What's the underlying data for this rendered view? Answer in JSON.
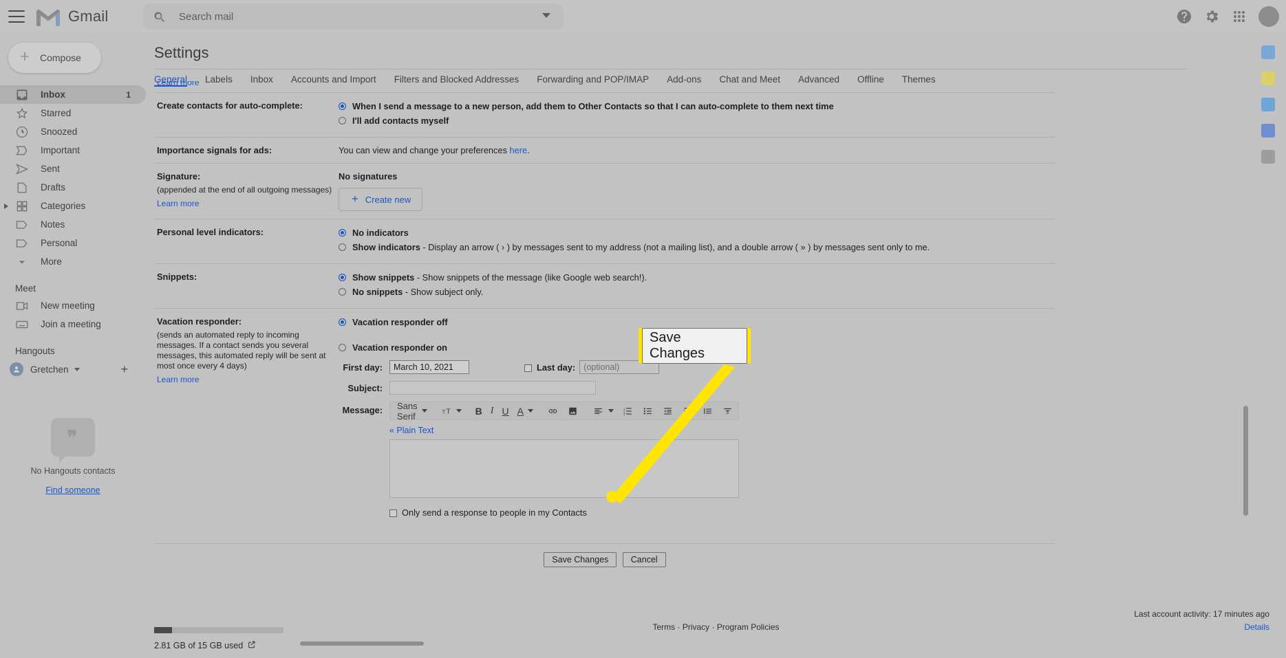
{
  "app": {
    "name": "Gmail",
    "menu_icon": "hamburger-menu-icon",
    "logo_icon": "gmail-m-logo"
  },
  "search": {
    "placeholder": "Search mail",
    "value": "",
    "icon": "search-icon",
    "options_icon": "chevron-down-icon"
  },
  "topbar": {
    "help_icon": "help-circle-icon",
    "settings_icon": "gear-icon",
    "apps_icon": "apps-grid-icon",
    "avatar": "account-avatar"
  },
  "sidebar": {
    "compose": {
      "label": "Compose",
      "icon": "plus-icon"
    },
    "items": [
      {
        "label": "Inbox",
        "icon": "inbox-icon",
        "count": "1",
        "active": true
      },
      {
        "label": "Starred",
        "icon": "star-icon",
        "count": ""
      },
      {
        "label": "Snoozed",
        "icon": "clock-icon",
        "count": ""
      },
      {
        "label": "Important",
        "icon": "label-important-icon",
        "count": ""
      },
      {
        "label": "Sent",
        "icon": "send-icon",
        "count": ""
      },
      {
        "label": "Drafts",
        "icon": "draft-icon",
        "count": ""
      },
      {
        "label": "Categories",
        "icon": "category-icon",
        "count": ""
      },
      {
        "label": "Notes",
        "icon": "label-icon",
        "count": ""
      },
      {
        "label": "Personal",
        "icon": "label-icon",
        "count": ""
      },
      {
        "label": "More",
        "icon": "chevron-down-icon",
        "count": ""
      }
    ],
    "meet": {
      "title": "Meet",
      "items": [
        {
          "label": "New meeting",
          "icon": "video-camera-icon"
        },
        {
          "label": "Join a meeting",
          "icon": "keyboard-icon"
        }
      ]
    },
    "hangouts": {
      "title": "Hangouts",
      "user": "Gretchen",
      "add_icon": "plus-icon",
      "empty_text": "No Hangouts contacts",
      "find_link": "Find someone"
    }
  },
  "settings": {
    "title": "Settings",
    "tabs": [
      {
        "label": "General",
        "active": true
      },
      {
        "label": "Labels",
        "active": false
      },
      {
        "label": "Inbox",
        "active": false
      },
      {
        "label": "Accounts and Import",
        "active": false
      },
      {
        "label": "Filters and Blocked Addresses",
        "active": false
      },
      {
        "label": "Forwarding and POP/IMAP",
        "active": false
      },
      {
        "label": "Add-ons",
        "active": false
      },
      {
        "label": "Chat and Meet",
        "active": false
      },
      {
        "label": "Advanced",
        "active": false
      },
      {
        "label": "Offline",
        "active": false
      },
      {
        "label": "Themes",
        "active": false
      }
    ],
    "cut_off_link": "Learn more",
    "rows": {
      "auto_complete": {
        "label": "Create contacts for auto-complete:",
        "option1": "When I send a message to a new person, add them to Other Contacts so that I can auto-complete to them next time",
        "option2": "I'll add contacts myself",
        "selected": 1
      },
      "importance_signals": {
        "label": "Importance signals for ads:",
        "text_before": "You can view and change your preferences ",
        "link": "here",
        "text_after": "."
      },
      "signature": {
        "label": "Signature:",
        "sub": "(appended at the end of all outgoing messages)",
        "learn_more": "Learn more",
        "status": "No signatures",
        "create_button": "Create new",
        "create_icon": "plus-icon"
      },
      "personal_level": {
        "label": "Personal level indicators:",
        "option1": "No indicators",
        "option2_bold": "Show indicators",
        "option2_rest": " - Display an arrow ( › ) by messages sent to my address (not a mailing list), and a double arrow ( » ) by messages sent only to me.",
        "selected": 1
      },
      "snippets": {
        "label": "Snippets:",
        "option1_bold": "Show snippets",
        "option1_rest": " - Show snippets of the message (like Google web search!).",
        "option2_bold": "No snippets",
        "option2_rest": " - Show subject only.",
        "selected": 1
      },
      "vacation": {
        "label": "Vacation responder:",
        "sub": "(sends an automated reply to incoming messages. If a contact sends you several messages, this automated reply will be sent at most once every 4 days)",
        "learn_more": "Learn more",
        "option_off": "Vacation responder off",
        "option_on": "Vacation responder on",
        "selected": 1,
        "first_day_label": "First day:",
        "first_day_value": "March 10, 2021",
        "last_day_label": "Last day:",
        "last_day_placeholder": "(optional)",
        "last_day_checked": false,
        "subject_label": "Subject:",
        "subject_value": "",
        "message_label": "Message:",
        "plain_text_link": "« Plain Text",
        "message_value": "",
        "contacts_only": "Only send a response to people in my Contacts",
        "contacts_only_checked": false
      }
    },
    "editor": {
      "font": "Sans Serif",
      "tools": [
        {
          "name": "font-family-dropdown",
          "glyph": "Sans Serif"
        },
        {
          "name": "font-size-icon",
          "glyph": "T"
        },
        {
          "name": "bold-icon",
          "glyph": "B"
        },
        {
          "name": "italic-icon",
          "glyph": "I"
        },
        {
          "name": "underline-icon",
          "glyph": "U"
        },
        {
          "name": "text-color-icon",
          "glyph": "A"
        },
        {
          "name": "insert-link-icon",
          "glyph": "link"
        },
        {
          "name": "insert-image-icon",
          "glyph": "image"
        },
        {
          "name": "align-icon",
          "glyph": "align"
        },
        {
          "name": "numbered-list-icon",
          "glyph": "ol"
        },
        {
          "name": "bulleted-list-icon",
          "glyph": "ul"
        },
        {
          "name": "indent-less-icon",
          "glyph": "indent-less"
        },
        {
          "name": "indent-more-icon",
          "glyph": "indent-more"
        },
        {
          "name": "quote-icon",
          "glyph": "quote"
        },
        {
          "name": "remove-formatting-icon",
          "glyph": "clear"
        }
      ]
    },
    "actions": {
      "save": "Save Changes",
      "cancel": "Cancel"
    }
  },
  "callout": {
    "label": "Save Changes",
    "highlight_color": "#ffe500",
    "arrow_color": "#ffe500"
  },
  "footer": {
    "storage_text": "2.81 GB of 15 GB used",
    "storage_icon": "open-in-new-icon",
    "storage_percent": 14,
    "links": [
      "Terms",
      "Privacy",
      "Program Policies"
    ],
    "separator": "·",
    "last_activity": "Last account activity: 17 minutes ago",
    "details_link": "Details"
  }
}
